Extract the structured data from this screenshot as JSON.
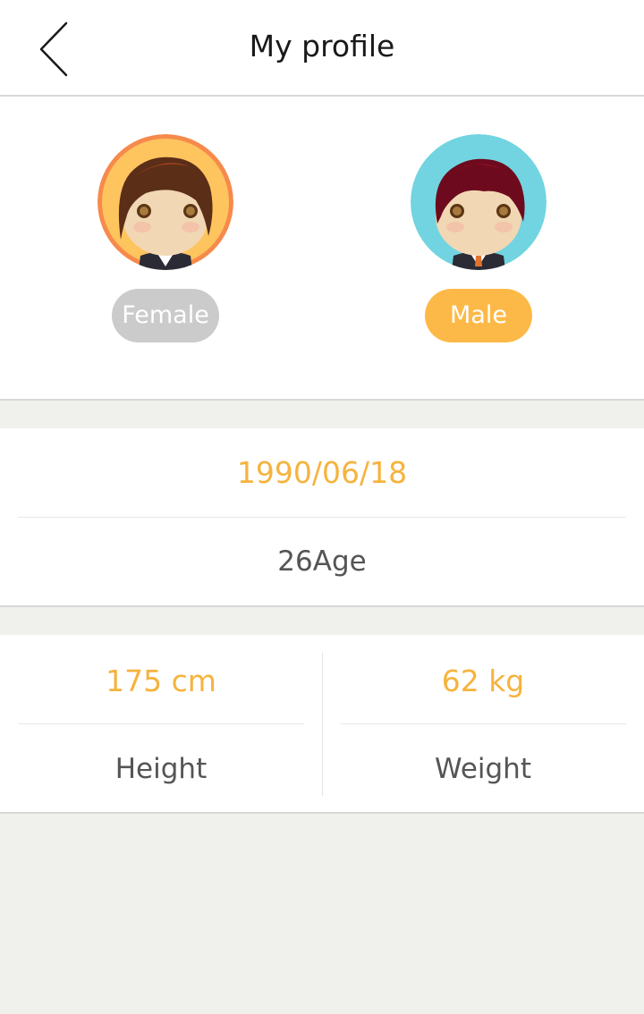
{
  "header": {
    "title": "My profile",
    "back_icon": "chevron-left-icon"
  },
  "gender": {
    "female_label": "Female",
    "male_label": "Male",
    "selected": "Male",
    "active_color": "#fdb947",
    "inactive_color": "#cbcbcb"
  },
  "birth": {
    "date": "1990/06/18",
    "age": "26Age"
  },
  "measurements": {
    "height_value": "175 cm",
    "height_label": "Height",
    "weight_value": "62 kg",
    "weight_label": "Weight"
  },
  "colors": {
    "accent": "#f6b33d",
    "text_gray": "#555555",
    "background": "#f0f0ec"
  }
}
